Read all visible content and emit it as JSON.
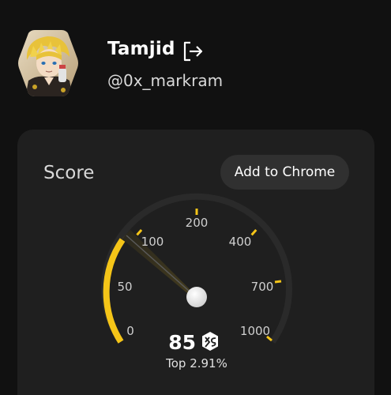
{
  "profile": {
    "name": "Tamjid",
    "handle": "@0x_markram",
    "logout_icon": "logout-icon",
    "avatar": "anime-character-avatar"
  },
  "score_card": {
    "title": "Score",
    "add_button_label": "Add to Chrome",
    "gauge": {
      "tick_labels": [
        "0",
        "50",
        "100",
        "200",
        "400",
        "700",
        "1000"
      ],
      "score": "85",
      "rank_text": "Top 2.91%",
      "badge_icon": "xs-hexagon-icon",
      "accent_color": "#f5c518"
    }
  }
}
